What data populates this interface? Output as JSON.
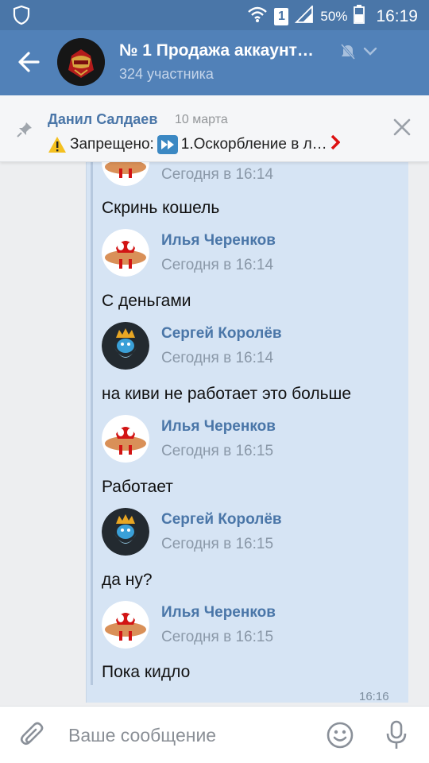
{
  "status_bar": {
    "battery": "50%",
    "time": "16:19",
    "sim": "1"
  },
  "header": {
    "title": "№ 1 Продажа аккаунт…",
    "subtitle": "324 участника"
  },
  "pinned": {
    "author": "Данил Салдаев",
    "date": "10 марта",
    "text_a": "Запрещено:",
    "text_b": "1.Оскорбление в л…"
  },
  "messages": [
    {
      "type": "header",
      "time": "Сегодня в 16:14",
      "avatar": "ilya"
    },
    {
      "type": "text",
      "text": "Скринь кошель"
    },
    {
      "type": "header",
      "name": "Илья Черенков",
      "time": "Сегодня в 16:14",
      "avatar": "ilya"
    },
    {
      "type": "text",
      "text": "С деньгами"
    },
    {
      "type": "header",
      "name": "Сергей Королёв",
      "time": "Сегодня в 16:14",
      "avatar": "sergey"
    },
    {
      "type": "text",
      "text": "на киви не работает это больше"
    },
    {
      "type": "header",
      "name": "Илья Черенков",
      "time": "Сегодня в 16:15",
      "avatar": "ilya"
    },
    {
      "type": "text",
      "text": "Работает"
    },
    {
      "type": "header",
      "name": "Сергей Королёв",
      "time": "Сегодня в 16:15",
      "avatar": "sergey"
    },
    {
      "type": "text",
      "text": "да ну?"
    },
    {
      "type": "header",
      "name": "Илья Черенков",
      "time": "Сегодня в 16:15",
      "avatar": "ilya"
    },
    {
      "type": "text",
      "text": "Пока кидло"
    }
  ],
  "bubble_time": "16:16",
  "composer": {
    "placeholder": "Ваше сообщение"
  },
  "colors": {
    "accent": "#5181b8",
    "link": "#4a76a8",
    "bubble": "#d6e4f4"
  }
}
